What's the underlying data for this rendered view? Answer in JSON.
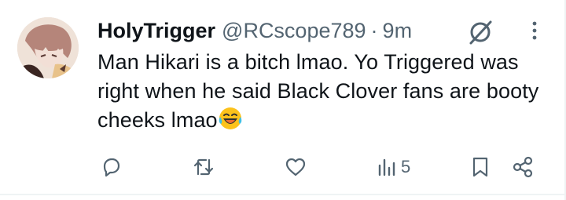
{
  "tweet": {
    "display_name": "HolyTrigger",
    "handle": "@RCscope789",
    "separator": "·",
    "time": "9m",
    "text": "Man Hikari is a bitch lmao. Yo Triggered was right when he said Black Clover fans are booty cheeks lmao",
    "emoji": "😂"
  },
  "actions": {
    "views_count": "5"
  },
  "icons": {
    "grok": "grok-icon",
    "more": "more-icon",
    "reply": "reply-icon",
    "retweet": "retweet-icon",
    "like": "like-icon",
    "views": "views-icon",
    "bookmark": "bookmark-icon",
    "share": "share-icon"
  },
  "colors": {
    "text": "#0f1419",
    "muted": "#536471",
    "divider": "#eff3f4"
  }
}
